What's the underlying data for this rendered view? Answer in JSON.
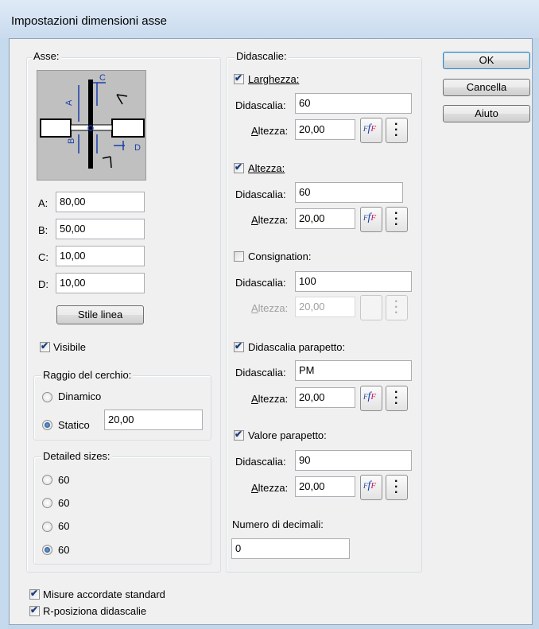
{
  "window": {
    "title": "Impostazioni dimensioni asse"
  },
  "asse": {
    "legend": "Asse:",
    "fields": [
      {
        "label": "A:",
        "value": "80,00"
      },
      {
        "label": "B:",
        "value": "50,00"
      },
      {
        "label": "C:",
        "value": "10,00"
      },
      {
        "label": "D:",
        "value": "10,00"
      }
    ],
    "preview_labels": {
      "a": "A",
      "b": "B",
      "c": "C",
      "d": "D"
    },
    "stile_linea": "Stile linea",
    "visibile": "Visibile",
    "raggio": {
      "legend": "Raggio del cerchio:",
      "dinamico": "Dinamico",
      "statico": "Statico",
      "statico_value": "20,00"
    },
    "detailed": {
      "legend": "Detailed sizes:",
      "options": [
        "60",
        "60",
        "60",
        "60"
      ]
    }
  },
  "didascalie": {
    "legend": "Didascalie:",
    "caption_label": "Didascalia:",
    "height_label": "Altezza:",
    "groups": [
      {
        "title": "Larghezza:",
        "caption": "60",
        "height": "20,00"
      },
      {
        "title": "Altezza:",
        "caption": "60",
        "height": "20,00"
      },
      {
        "title": "Consignation:",
        "caption": "100",
        "height": "20,00"
      },
      {
        "title": "Didascalia parapetto:",
        "caption": "PM",
        "height": "20,00"
      },
      {
        "title": "Valore parapetto:",
        "caption": "90",
        "height": "20,00"
      }
    ],
    "decimals_label": "Numero di decimali:",
    "decimals_value": "0"
  },
  "buttons": {
    "ok": "OK",
    "cancel": "Cancella",
    "help": "Aiuto"
  },
  "bottom": {
    "misure": "Misure accordate standard",
    "riposiziona": "R-posiziona didascalie"
  },
  "colors": {
    "accent": "#15428b",
    "font_icon_blue": "#1a3fa8",
    "font_icon_red": "#c02060"
  }
}
